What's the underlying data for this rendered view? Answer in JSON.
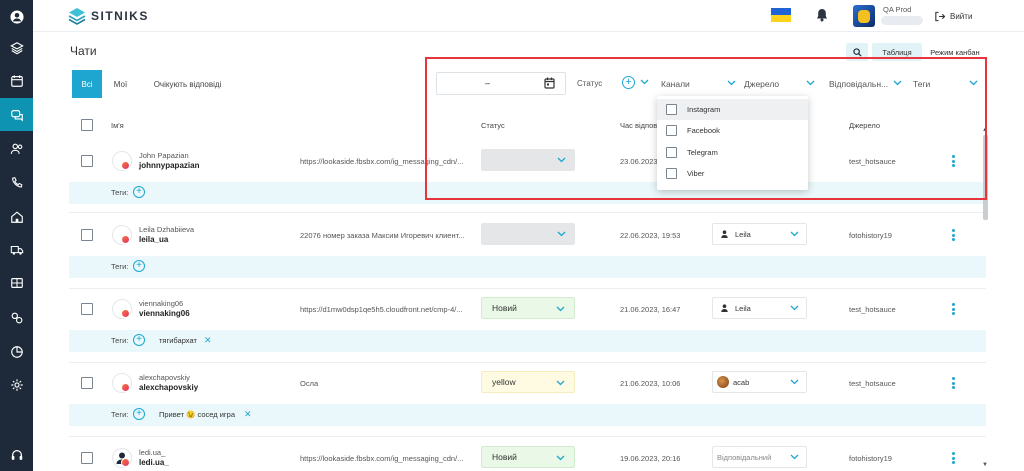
{
  "app": {
    "logo": "SITNIKS"
  },
  "header": {
    "user_name": "QA Prod",
    "logout_label": "Вийти"
  },
  "page": {
    "title": "Чати"
  },
  "views": {
    "table_label": "Таблиця",
    "kanban_label": "Режим канбан"
  },
  "tabs": {
    "all": "Всі",
    "mine": "Мої",
    "waiting": "Очікують відповіді"
  },
  "filters": {
    "date_separator": "–",
    "status_label": "Статус",
    "channels": "Канали",
    "source": "Джерело",
    "responsible": "Відповідальн...",
    "tags": "Теги"
  },
  "channels_dropdown": {
    "options": [
      "Instagram",
      "Facebook",
      "Telegram",
      "Viber"
    ]
  },
  "table": {
    "columns": {
      "name": "Ім'я",
      "status": "Статус",
      "time": "Час відпов",
      "source": "Джерело"
    },
    "tags_label": "Теги:",
    "rows": [
      {
        "name": "John Papazian",
        "username": "johnnypapazian",
        "message": "https://lookaside.fbsbx.com/ig_messaging_cdn/...",
        "status": "",
        "time": "23.06.2023, 20:11",
        "responsible": "",
        "source": "test_hotsauce",
        "tags": []
      },
      {
        "name": "Leila Dzhabiieva",
        "username": "leila_ua",
        "message": "22076 номер заказа Максим Игоревич клиент...",
        "status": "",
        "time": "22.06.2023, 19:53",
        "responsible": "Leila",
        "source": "fotohistory19",
        "tags": []
      },
      {
        "name": "viennaking06",
        "username": "viennaking06",
        "message": "https://d1mw0dsp1qe5h5.cloudfront.net/cmp-4/...",
        "status": "Новий",
        "time": "21.06.2023, 16:47",
        "responsible": "Leila",
        "source": "test_hotsauce",
        "tags": [
          "тягибархат"
        ]
      },
      {
        "name": "alexchapovskiy",
        "username": "alexchapovskiy",
        "message": "Осла",
        "status": "yellow",
        "time": "21.06.2023, 10:06",
        "responsible": "acab",
        "source": "test_hotsauce",
        "tags": [
          "Привет 😉 сосед игра"
        ]
      },
      {
        "name": "ledi.ua_",
        "username": "ledi.ua_",
        "message": "https://lookaside.fbsbx.com/ig_messaging_cdn/...",
        "status": "Новий",
        "time": "19.06.2023, 20:16",
        "responsible": "Відповідальний",
        "source": "fotohistory19",
        "tags": []
      }
    ]
  },
  "colors": {
    "accent": "#1ea6d1",
    "nav_bg": "#1e2a3a",
    "highlight": "#e8343c",
    "tag_band": "#eaf8fb"
  }
}
